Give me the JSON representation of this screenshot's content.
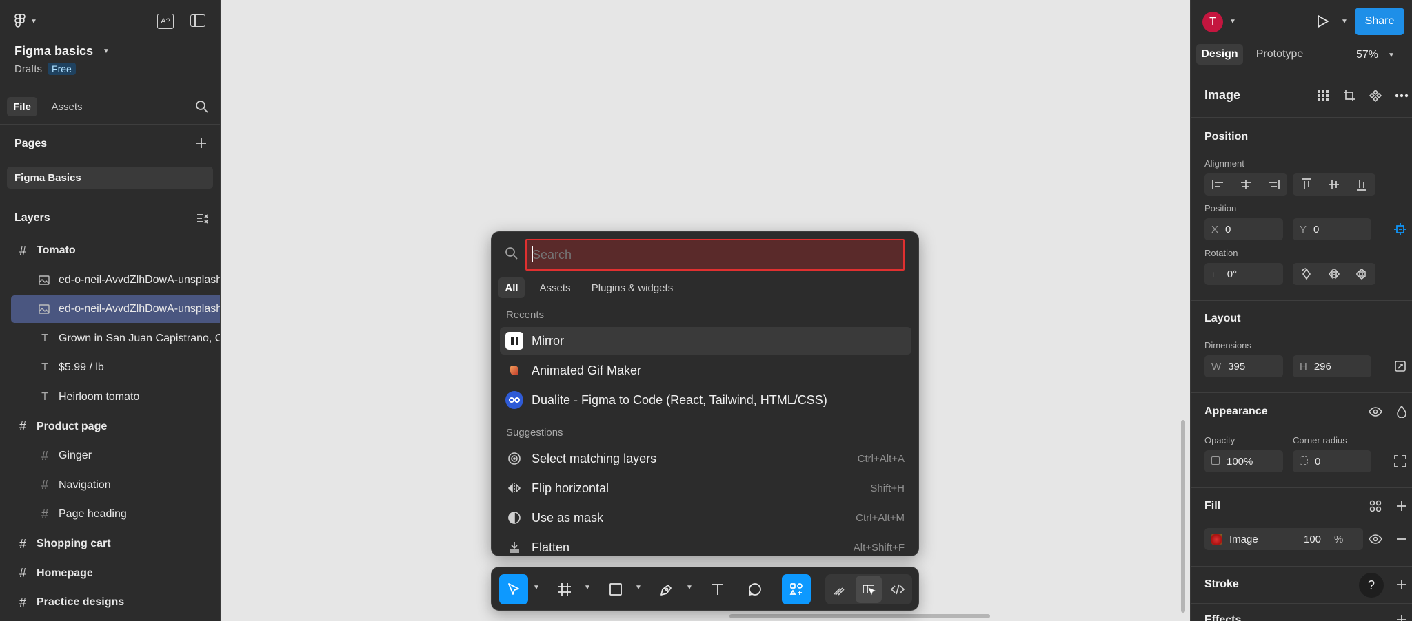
{
  "file": {
    "name": "Figma basics",
    "location": "Drafts",
    "plan_badge": "Free"
  },
  "left_tabs": [
    "File",
    "Assets"
  ],
  "pages": {
    "title": "Pages",
    "items": [
      "Figma Basics"
    ]
  },
  "layers": {
    "title": "Layers",
    "items": [
      {
        "label": "Tomato",
        "type": "frame",
        "indent": 0,
        "selected": false
      },
      {
        "label": "ed-o-neil-AvvdZlhDowA-unsplash",
        "type": "image",
        "indent": 1,
        "selected": false
      },
      {
        "label": "ed-o-neil-AvvdZlhDowA-unsplash",
        "type": "image",
        "indent": 1,
        "selected": true
      },
      {
        "label": "Grown in San Juan Capistrano, CA",
        "type": "text",
        "indent": 1,
        "selected": false
      },
      {
        "label": "$5.99 / lb",
        "type": "text",
        "indent": 1,
        "selected": false
      },
      {
        "label": "Heirloom tomato",
        "type": "text",
        "indent": 1,
        "selected": false
      },
      {
        "label": "Product page",
        "type": "frame",
        "indent": 0,
        "selected": false
      },
      {
        "label": "Ginger",
        "type": "frame",
        "indent": 1,
        "selected": false
      },
      {
        "label": "Navigation",
        "type": "frame",
        "indent": 1,
        "selected": false
      },
      {
        "label": "Page heading",
        "type": "frame",
        "indent": 1,
        "selected": false
      },
      {
        "label": "Shopping cart",
        "type": "frame",
        "indent": 0,
        "selected": false
      },
      {
        "label": "Homepage",
        "type": "frame",
        "indent": 0,
        "selected": false
      },
      {
        "label": "Practice designs",
        "type": "frame",
        "indent": 0,
        "selected": false
      }
    ]
  },
  "quick_actions": {
    "search_placeholder": "Search",
    "search_value": "",
    "tabs": [
      "All",
      "Assets",
      "Plugins & widgets"
    ],
    "active_tab": "All",
    "recents_title": "Recents",
    "recents": [
      {
        "label": "Mirror",
        "icon": "mirror-plugin-icon"
      },
      {
        "label": "Animated Gif Maker",
        "icon": "gif-maker-icon"
      },
      {
        "label": "Dualite - Figma to Code (React, Tailwind, HTML/CSS)",
        "icon": "dualite-icon"
      }
    ],
    "suggestions_title": "Suggestions",
    "suggestions": [
      {
        "label": "Select matching layers",
        "shortcut": "Ctrl+Alt+A",
        "icon": "target-icon"
      },
      {
        "label": "Flip horizontal",
        "shortcut": "Shift+H",
        "icon": "flip-horizontal-icon"
      },
      {
        "label": "Use as mask",
        "shortcut": "Ctrl+Alt+M",
        "icon": "mask-icon"
      },
      {
        "label": "Flatten",
        "shortcut": "Alt+Shift+F",
        "icon": "flatten-icon"
      }
    ]
  },
  "header_right": {
    "avatar_letter": "T",
    "share_label": "Share",
    "tabs": [
      "Design",
      "Prototype"
    ],
    "zoom": "57%"
  },
  "design": {
    "selection_title": "Image",
    "position": {
      "title": "Position",
      "alignment_label": "Alignment",
      "position_label": "Position",
      "x_prefix": "X",
      "x": "0",
      "y_prefix": "Y",
      "y": "0",
      "rotation_label": "Rotation",
      "rotation": "0°"
    },
    "layout": {
      "title": "Layout",
      "dimensions_label": "Dimensions",
      "w_prefix": "W",
      "w": "395",
      "h_prefix": "H",
      "h": "296"
    },
    "appearance": {
      "title": "Appearance",
      "opacity_label": "Opacity",
      "opacity": "100%",
      "corner_label": "Corner radius",
      "corner": "0"
    },
    "fill": {
      "title": "Fill",
      "type": "Image",
      "opacity": "100",
      "unit": "%"
    },
    "stroke": {
      "title": "Stroke"
    },
    "effects": {
      "title": "Effects"
    },
    "help": "?"
  },
  "colors": {
    "accent": "#0d99ff",
    "share": "#1e8fe8",
    "avatar": "#c4163f",
    "search_highlight": "#e03030"
  }
}
